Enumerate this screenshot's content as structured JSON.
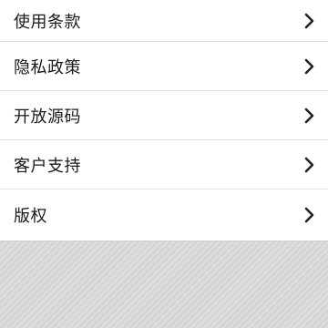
{
  "menu": {
    "items": [
      {
        "label": "使用条款",
        "icon": "chevron-right-icon"
      },
      {
        "label": "隐私政策",
        "icon": "chevron-right-icon"
      },
      {
        "label": "开放源码",
        "icon": "chevron-right-icon"
      },
      {
        "label": "客户支持",
        "icon": "chevron-right-icon"
      },
      {
        "label": "版权",
        "icon": "chevron-right-icon"
      }
    ]
  },
  "colors": {
    "list_background": "#ffffff",
    "text": "#1a1a1a",
    "divider": "#e2e2e2",
    "empty_area": "#d9d9d9"
  }
}
